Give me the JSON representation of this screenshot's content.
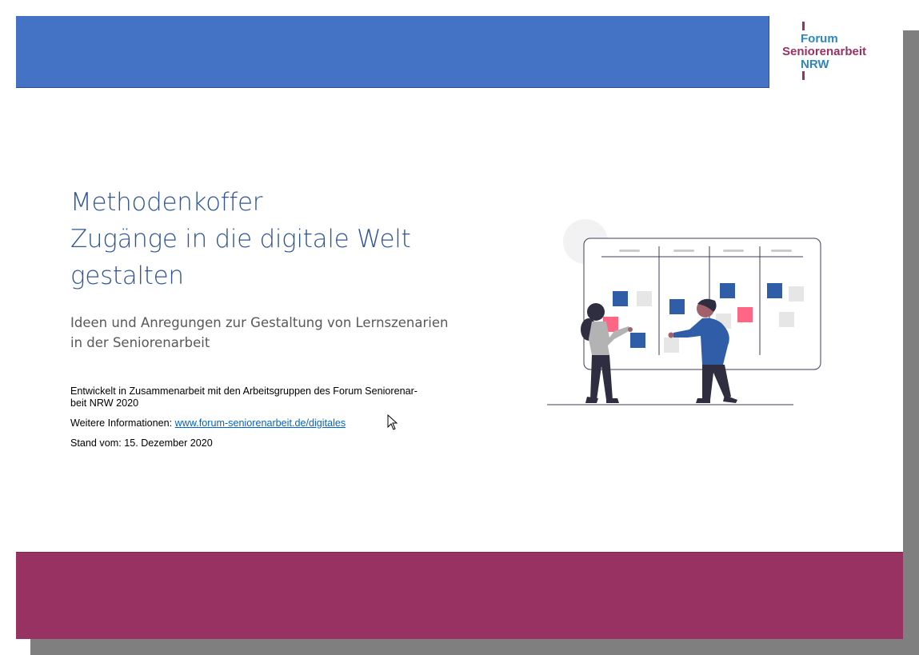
{
  "logo": {
    "line1": "Forum",
    "line2": "Seniorenarbeit",
    "line3": "NRW"
  },
  "document": {
    "title_lines": [
      "Methodenkoffer",
      "Zugänge in die digitale Welt",
      "gestalten"
    ],
    "subtitle_lines": [
      "Ideen und Anregungen zur Gestaltung von Lernszenarien",
      "in der Seniorenarbeit"
    ],
    "developed_lines": [
      "Entwickelt in Zusammenarbeit mit den Arbeitsgruppen des Forum Seniorenar-",
      "beit NRW 2020"
    ],
    "info_label": "Weitere Informationen: ",
    "info_link": "www.forum-seniorenarbeit.de/digitales",
    "date_text": "Stand vom: 15. Dezember 2020"
  },
  "colors": {
    "header": "#4472c4",
    "footer": "#983262",
    "title": "#2f5597",
    "logo_blue": "#2e86c1",
    "logo_red": "#983262"
  },
  "icons": {
    "illustration": "kanban-board-people-illustration",
    "cursor": "mouse-pointer-icon"
  }
}
